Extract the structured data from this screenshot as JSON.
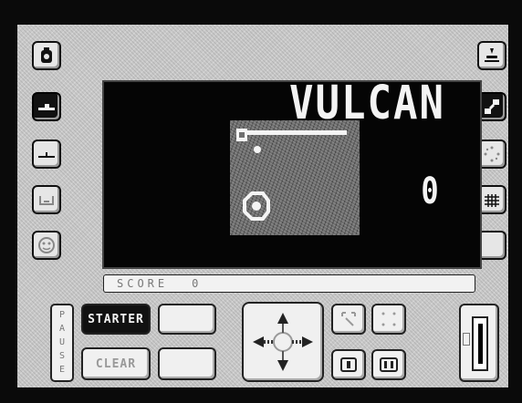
{
  "game": {
    "title": "VULCAN",
    "score_display": "0"
  },
  "score_bar": {
    "label": "SCORE",
    "value": "0"
  },
  "controls": {
    "pause_letters": [
      "P",
      "A",
      "U",
      "S",
      "E"
    ],
    "start_label": "STARTER",
    "clear_label": "CLEAR",
    "blank_top_label": "",
    "blank_bottom_label": ""
  },
  "colors": {
    "screen": "#050505",
    "panel": "#c9c9c9",
    "text": "#f4f4f4"
  },
  "icons": {
    "left_side": [
      "jar-icon",
      "boat-icon",
      "ground-icon",
      "container-icon",
      "face-icon"
    ],
    "right_side": [
      "figure-icon",
      "step-icon",
      "dots-circle-icon",
      "grid-icon",
      "blank-icon"
    ],
    "keypad": [
      "dpad-arrows-icon",
      "corner-dots-icon",
      "square-dots-icon",
      "slot-one-icon",
      "slot-two-icon",
      "lever-icon"
    ]
  }
}
